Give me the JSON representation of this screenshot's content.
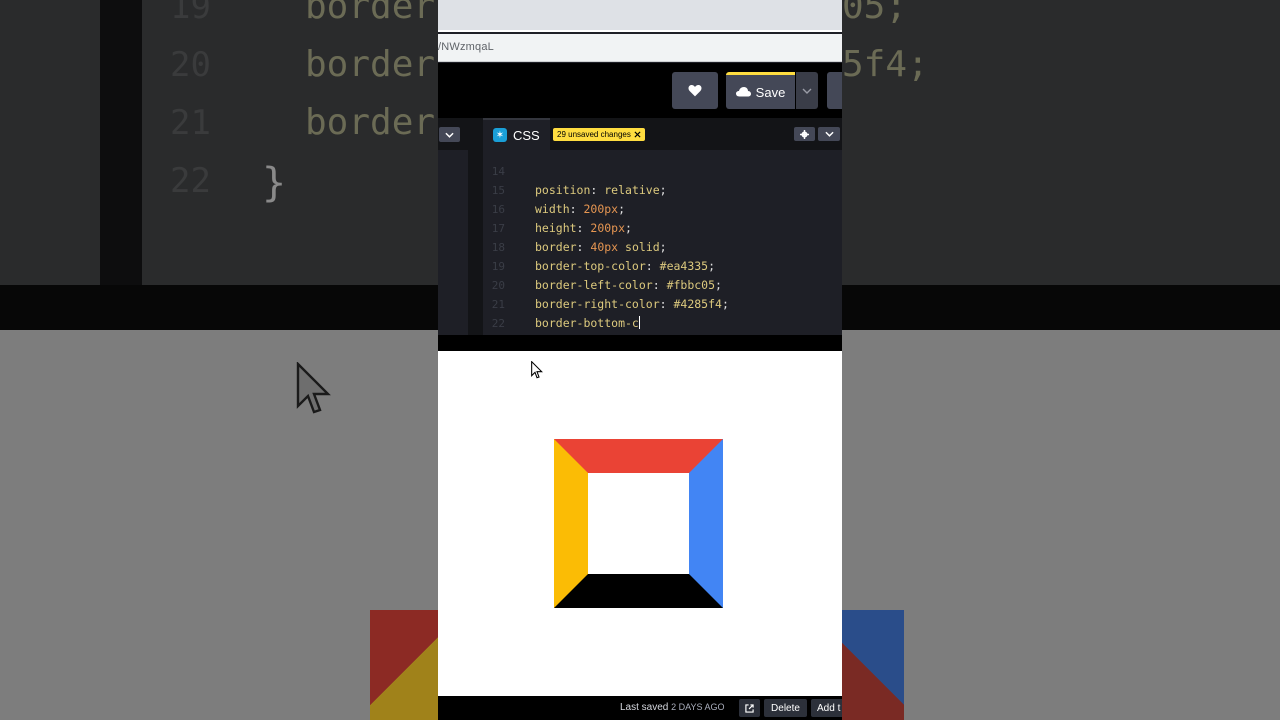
{
  "background": {
    "line_numbers": [
      "19",
      "20",
      "21",
      "22"
    ],
    "code_fragments": [
      "border",
      "border",
      "border"
    ],
    "right_fragments": [
      "05;",
      "5f4;"
    ],
    "brace": "}"
  },
  "browser": {
    "url_fragment": "/NWzmqaL"
  },
  "header": {
    "save_label": "Save",
    "heart_icon": "heart-icon",
    "cloud_icon": "cloud-icon"
  },
  "editor": {
    "tab_label": "CSS",
    "badge_glyph": "✶",
    "unsaved_label": "29 unsaved changes",
    "lines": [
      {
        "num": "14",
        "prop": "position",
        "val": "relative",
        "val_type": "val"
      },
      {
        "num": "15",
        "prop": "width",
        "val": "200px",
        "val_type": "num"
      },
      {
        "num": "16",
        "prop": "height",
        "val": "200px",
        "val_type": "num"
      },
      {
        "num": "17",
        "prop": "border",
        "val_num": "40px",
        "val": "solid",
        "val_type": "mixed"
      },
      {
        "num": "18",
        "prop": "border-top-color",
        "val": "#ea4335",
        "val_type": "val"
      },
      {
        "num": "19",
        "prop": "border-left-color",
        "val": "#fbbc05",
        "val_type": "val"
      },
      {
        "num": "20",
        "prop": "border-right-color",
        "val": "#4285f4",
        "val_type": "val"
      },
      {
        "num": "21",
        "typed": "border-bottom-c"
      },
      {
        "num": "22",
        "brace": "}"
      }
    ]
  },
  "preview": {
    "border_colors": {
      "top": "#ea4335",
      "left": "#fbbc05",
      "right": "#4285f4",
      "bottom": "#000000"
    }
  },
  "footer": {
    "last_saved_label": "Last saved",
    "last_saved_ago": "2 DAYS AGO",
    "delete_label": "Delete",
    "add_label": "Add t"
  }
}
